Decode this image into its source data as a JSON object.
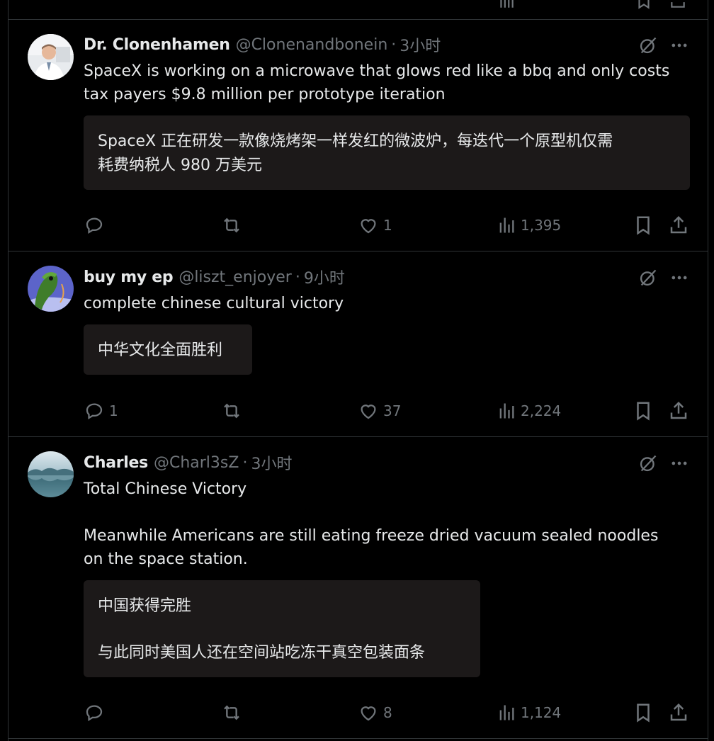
{
  "posts": [
    {
      "name": "Dr. Clonenhamen",
      "handle": "@Clonenandbonein",
      "separator": "·",
      "time": "3小时",
      "text_lines": [
        "SpaceX is working on a microwave that glows red like a bbq and only costs",
        "tax payers $9.8 million per prototype iteration"
      ],
      "translation_lines": [
        "SpaceX 正在研发一款像烧烤架一样发红的微波炉，每迭代一个原型机仅需",
        "耗费纳税人 980 万美元"
      ],
      "replies": "",
      "reposts": "",
      "likes": "1",
      "views": "1,395",
      "avatar_icon": "doctor-avatar"
    },
    {
      "name": "buy my ep",
      "handle": "@liszt_enjoyer",
      "separator": "·",
      "time": "9小时",
      "text_lines": [
        "complete chinese cultural victory"
      ],
      "translation_lines": [
        "中华文化全面胜利"
      ],
      "replies": "1",
      "reposts": "",
      "likes": "37",
      "views": "2,224",
      "avatar_icon": "frog-avatar"
    },
    {
      "name": "Charles",
      "handle": "@Charl3sZ",
      "separator": "·",
      "time": "3小时",
      "text_lines": [
        "Total Chinese Victory",
        "",
        "Meanwhile Americans are still eating freeze dried vacuum sealed noodles",
        "on the space station."
      ],
      "translation_lines": [
        "中国获得完胜",
        "",
        "与此同时美国人还在空间站吃冻干真空包装面条"
      ],
      "replies": "",
      "reposts": "",
      "likes": "8",
      "views": "1,124",
      "avatar_icon": "lake-avatar"
    }
  ],
  "colors": {
    "background": "#000000",
    "text": "#e7e9ea",
    "muted": "#71767b",
    "border": "#2f3336",
    "translation_bg": "#1c1919"
  }
}
